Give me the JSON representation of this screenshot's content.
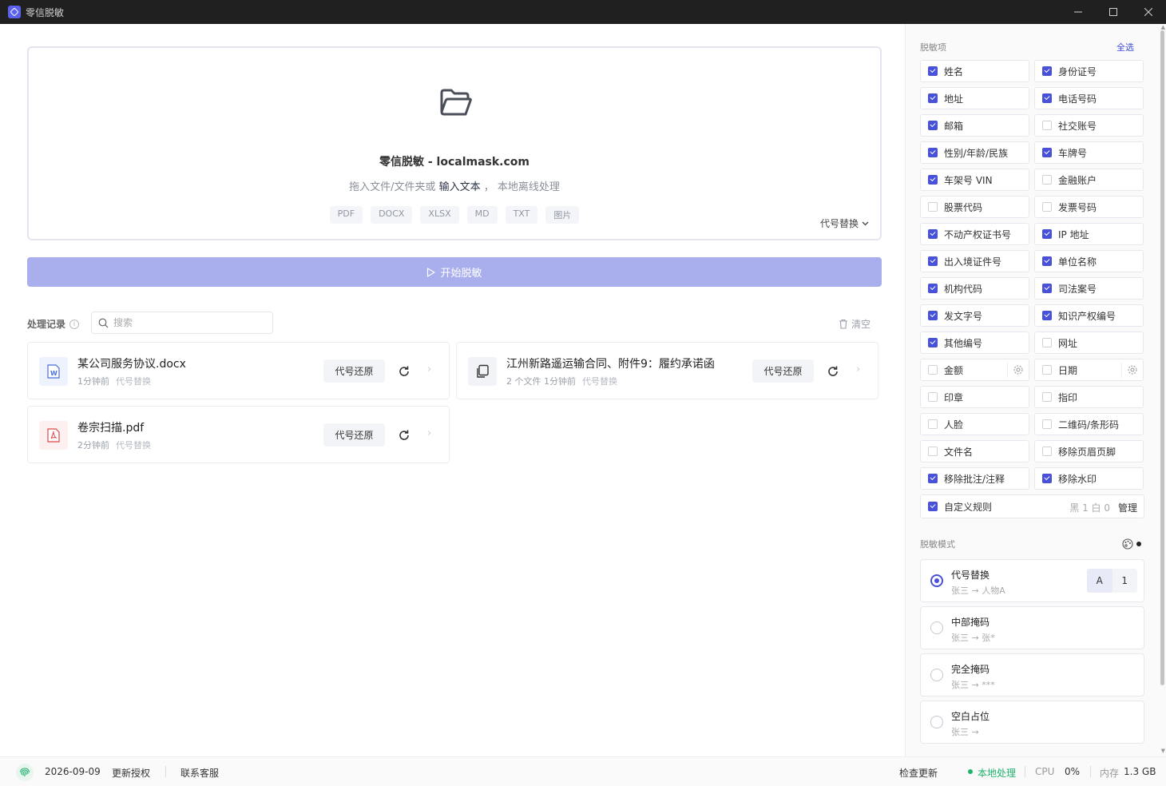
{
  "window": {
    "title": "零信脱敏"
  },
  "dropzone": {
    "title": "零信脱敏 - localmask.com",
    "sub_prefix": "拖入文件/文件夹或",
    "sub_link": "输入文本",
    "sub_suffix": "， 本地离线处理",
    "types": [
      "PDF",
      "DOCX",
      "XLSX",
      "MD",
      "TXT",
      "图片"
    ],
    "mode_label": "代号替换"
  },
  "start_button": "开始脱敏",
  "records": {
    "label": "处理记录",
    "search_placeholder": "搜索",
    "clear_label": "清空",
    "items": [
      {
        "name": "某公司服务协议.docx",
        "meta": "1分钟前",
        "mode": "代号替换",
        "action": "代号还原"
      },
      {
        "name": "江州新路遥运输合同、附件9：履约承诺函",
        "meta": "2 个文件   1分钟前",
        "mode": "代号替换",
        "action": "代号还原"
      },
      {
        "name": "卷宗扫描.pdf",
        "meta": "2分钟前",
        "mode": "代号替换",
        "action": "代号还原"
      }
    ]
  },
  "side": {
    "items_title": "脱敏项",
    "select_all": "全选",
    "options": [
      {
        "label": "姓名",
        "checked": true
      },
      {
        "label": "身份证号",
        "checked": true
      },
      {
        "label": "地址",
        "checked": true
      },
      {
        "label": "电话号码",
        "checked": true
      },
      {
        "label": "邮箱",
        "checked": true
      },
      {
        "label": "社交账号",
        "checked": false
      },
      {
        "label": "性别/年龄/民族",
        "checked": true
      },
      {
        "label": "车牌号",
        "checked": true
      },
      {
        "label": "车架号 VIN",
        "checked": true
      },
      {
        "label": "金融账户",
        "checked": false
      },
      {
        "label": "股票代码",
        "checked": false
      },
      {
        "label": "发票号码",
        "checked": false
      },
      {
        "label": "不动产权证书号",
        "checked": true
      },
      {
        "label": "IP 地址",
        "checked": true
      },
      {
        "label": "出入境证件号",
        "checked": true
      },
      {
        "label": "单位名称",
        "checked": true
      },
      {
        "label": "机构代码",
        "checked": true
      },
      {
        "label": "司法案号",
        "checked": true
      },
      {
        "label": "发文字号",
        "checked": true
      },
      {
        "label": "知识产权编号",
        "checked": true
      },
      {
        "label": "其他编号",
        "checked": true
      },
      {
        "label": "网址",
        "checked": false
      },
      {
        "label": "金额",
        "checked": false,
        "gear": true
      },
      {
        "label": "日期",
        "checked": false,
        "gear": true
      },
      {
        "label": "印章",
        "checked": false
      },
      {
        "label": "指印",
        "checked": false
      },
      {
        "label": "人脸",
        "checked": false
      },
      {
        "label": "二维码/条形码",
        "checked": false
      },
      {
        "label": "文件名",
        "checked": false
      },
      {
        "label": "移除页眉页脚",
        "checked": false
      },
      {
        "label": "移除批注/注释",
        "checked": true
      },
      {
        "label": "移除水印",
        "checked": true
      }
    ],
    "custom_rule": {
      "label": "自定义规则",
      "checked": true,
      "counts": "黑 1   白 0",
      "manage": "管理"
    },
    "mode_title": "脱敏模式",
    "modes": [
      {
        "name": "代号替换",
        "example": "张三 → 人物A",
        "selected": true,
        "toggle": [
          "A",
          "1"
        ]
      },
      {
        "name": "中部掩码",
        "example": "张三 → 张*",
        "selected": false
      },
      {
        "name": "完全掩码",
        "example": "张三 → ***",
        "selected": false
      },
      {
        "name": "空白占位",
        "example": "张三 →",
        "selected": false
      }
    ]
  },
  "status": {
    "date": "2026-09-09",
    "renew": "更新授权",
    "contact": "联系客服",
    "check_update": "检查更新",
    "local": "本地处理",
    "cpu_label": "CPU",
    "cpu_value": "0%",
    "mem_label": "内存",
    "mem_value": "1.3 GB"
  },
  "colors": {
    "accent": "#4851d8",
    "start_disabled": "#a9aeec",
    "ok": "#1fb36c"
  }
}
